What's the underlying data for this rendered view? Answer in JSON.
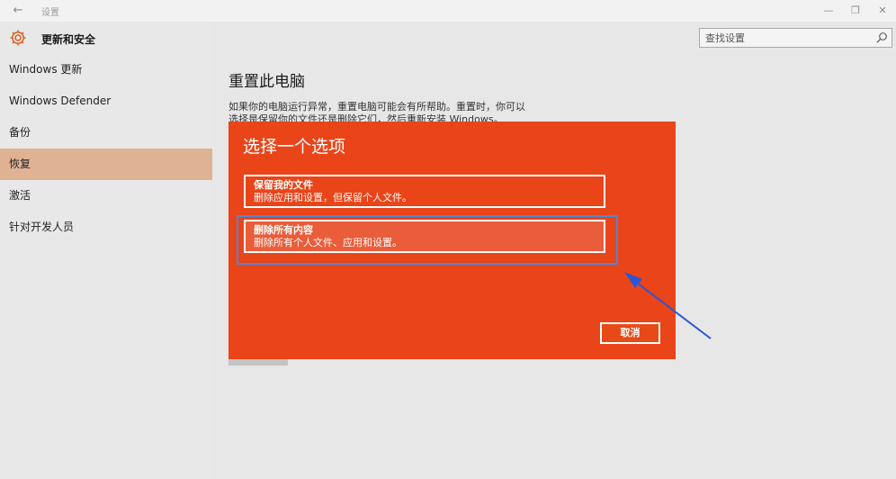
{
  "titlebar": {
    "back_glyph": "←",
    "title": "设置",
    "minimize_glyph": "—",
    "restore_glyph": "❐",
    "close_glyph": "✕"
  },
  "sidebar": {
    "header_title": "更新和安全",
    "header_icon": "gear-icon",
    "items": [
      {
        "label": "Windows 更新"
      },
      {
        "label": "Windows Defender"
      },
      {
        "label": "备份"
      },
      {
        "label": "恢复",
        "active": true
      },
      {
        "label": "激活"
      },
      {
        "label": "针对开发人员"
      }
    ]
  },
  "search": {
    "placeholder": "查找设置",
    "icon": "search-icon"
  },
  "main": {
    "section_title": "重置此电脑",
    "description": "如果你的电脑运行异常，重置电脑可能会有所帮助。重置时，你可以选择是保留你的文件还是删除它们，然后重新安装 Windows。"
  },
  "dialog": {
    "title": "选择一个选项",
    "options": [
      {
        "title": "保留我的文件",
        "desc": "删除应用和设置，但保留个人文件。"
      },
      {
        "title": "删除所有内容",
        "desc": "删除所有个人文件、应用和设置。"
      }
    ],
    "cancel_label": "取消"
  },
  "colors": {
    "dialog_bg": "#ea4419",
    "accent_active": "#e0b294",
    "highlight": "#4d86d9"
  }
}
